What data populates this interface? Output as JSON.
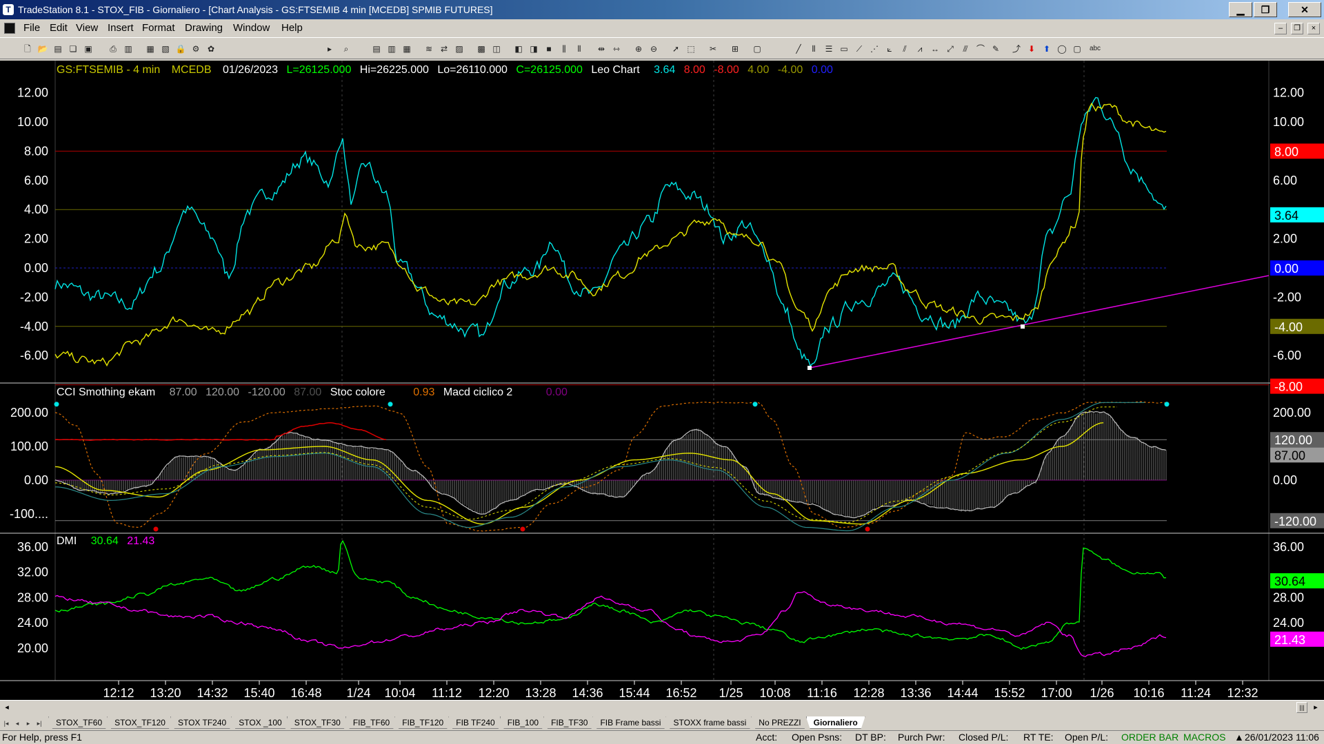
{
  "window": {
    "title": "TradeStation 8.1 - STOX_FIB - Giornaliero - [Chart Analysis - GS:FTSEMIB  4 min  [MCEDB] SPMIB FUTURES]",
    "min": "▁",
    "max": "❐",
    "close": "✕"
  },
  "menu": [
    "File",
    "Edit",
    "View",
    "Insert",
    "Format",
    "Drawing",
    "Window",
    "Help"
  ],
  "mdi": {
    "min": "–",
    "restore": "❐",
    "close": "×"
  },
  "toolbar": {
    "symbol_value": "A"
  },
  "chart": {
    "header": {
      "symbol": "GS:FTSEMIB - 4 min",
      "exchange": "MCEDB",
      "date": "01/26/2023",
      "last": "L=26125.000",
      "high": "Hi=26225.000",
      "low": "Lo=26110.000",
      "close": "C=26125.000",
      "study": "Leo Chart",
      "values": [
        {
          "text": "3.64",
          "color": "#00e5e5"
        },
        {
          "text": "8.00",
          "color": "#ff2020"
        },
        {
          "text": "-8.00",
          "color": "#ff2020"
        },
        {
          "text": "4.00",
          "color": "#9a9a00"
        },
        {
          "text": "-4.00",
          "color": "#9a9a00"
        },
        {
          "text": "0.00",
          "color": "#2020ff"
        }
      ]
    },
    "pane1": {
      "ylabels": [
        "12.00",
        "10.00",
        "8.00",
        "6.00",
        "4.00",
        "2.00",
        "0.00",
        "-2.00",
        "-4.00",
        "-6.00"
      ],
      "right_labels": [
        "12.00",
        "10.00",
        "6.00",
        "2.00",
        "-2.00",
        "-6.00"
      ],
      "badges": [
        {
          "text": "8.00",
          "bg": "#ff0000",
          "fg": "#ffffff"
        },
        {
          "text": "3.64",
          "bg": "#00ffff",
          "fg": "#000000"
        },
        {
          "text": "0.00",
          "bg": "#0000ff",
          "fg": "#ffffff"
        },
        {
          "text": "-4.00",
          "bg": "#6b6b00",
          "fg": "#ffffff"
        },
        {
          "text": "-8.00",
          "bg": "#ff0000",
          "fg": "#ffffff"
        }
      ]
    },
    "pane2": {
      "header": {
        "name": "CCI Smothing ekam",
        "v1": "87.00",
        "v2": "120.00",
        "v3": "-120.00",
        "v4": "87.00",
        "name2": "Stoc colore",
        "v5": "0.93",
        "name3": "Macd ciclico 2",
        "v6": "0.00"
      },
      "ylabels": [
        "200.00",
        "100.00",
        "0.00",
        "-100...."
      ],
      "right_labels": [
        "200.00",
        "0.00"
      ],
      "badges": [
        {
          "text": "120.00",
          "bg": "#606060",
          "fg": "#ffffff"
        },
        {
          "text": "87.00",
          "bg": "#9a9a9a",
          "fg": "#000000"
        },
        {
          "text": "-120.00",
          "bg": "#606060",
          "fg": "#ffffff"
        }
      ]
    },
    "pane3": {
      "header": {
        "name": "DMI",
        "v1": "30.64",
        "v2": "21.43"
      },
      "ylabels": [
        "36.00",
        "32.00",
        "28.00",
        "24.00",
        "20.00"
      ],
      "right_labels": [
        "36.00",
        "28.00",
        "24.00"
      ],
      "badges": [
        {
          "text": "30.64",
          "bg": "#00ff00",
          "fg": "#000000"
        },
        {
          "text": "21.43",
          "bg": "#ff00ff",
          "fg": "#ffffff"
        }
      ]
    },
    "xlabels": [
      "12:12",
      "13:20",
      "14:32",
      "15:40",
      "16:48",
      "1/24",
      "10:04",
      "11:12",
      "12:20",
      "13:28",
      "14:36",
      "15:44",
      "16:52",
      "1/25",
      "10:08",
      "11:16",
      "12:28",
      "13:36",
      "14:44",
      "15:52",
      "17:00",
      "1/26",
      "10:16",
      "11:24",
      "12:32"
    ]
  },
  "tabs": [
    "STOX_TF60",
    "STOX_TF120",
    "STOX TF240",
    "STOX _100",
    "STOX_TF30",
    "FIB_TF60",
    "FIB_TF120",
    "FIB TF240",
    "FIB_100",
    "FIB_TF30",
    "FIB Frame bassi",
    "STOXX frame bassi",
    "No PREZZI",
    "Giornaliero"
  ],
  "active_tab": "Giornaliero",
  "status": {
    "help": "For Help, press F1",
    "acct": "Acct:",
    "open_psns": "Open Psns:",
    "dt_bp": "DT BP:",
    "purch_pwr": "Purch Pwr:",
    "closed_pl": "Closed P/L:",
    "rt_te": "RT TE:",
    "open_pl": "Open P/L:",
    "order_bar": "ORDER BAR",
    "macros": "MACROS",
    "datetime": "26/01/2023 11:06"
  }
}
